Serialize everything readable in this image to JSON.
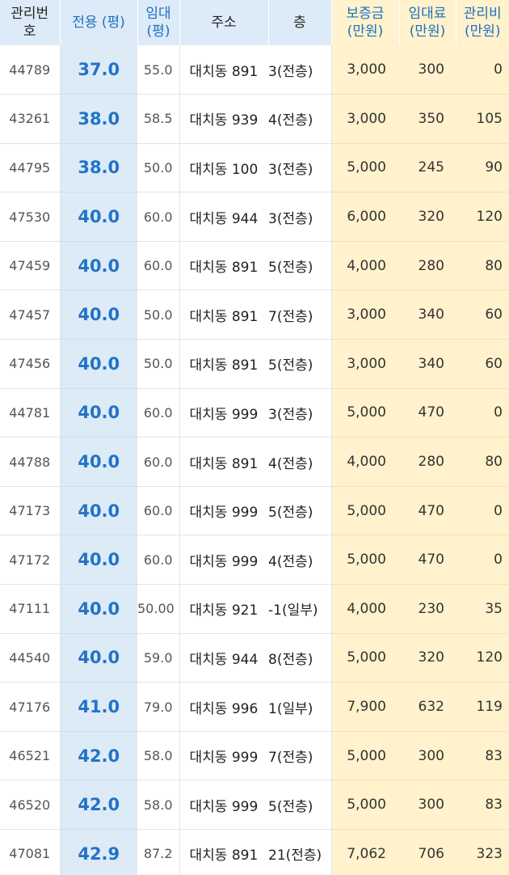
{
  "headers": {
    "id": [
      "관리번",
      "호"
    ],
    "area": [
      "전용 (평)"
    ],
    "rent_area": [
      "임대",
      "(평)"
    ],
    "address": [
      "주소"
    ],
    "floor": [
      "층"
    ],
    "deposit": [
      "보증금",
      "(만원)"
    ],
    "monthly": [
      "임대료",
      "(만원)"
    ],
    "fee": [
      "관리비",
      "(만원)"
    ]
  },
  "colors": {
    "area_column_bg": "#ddebf7",
    "area_text": "#2273c8",
    "money_columns_bg": "#fff2cc",
    "header_bg": "#dcebf7"
  },
  "rows": [
    {
      "id": "44789",
      "area": "37.0",
      "rent_area": "55.0",
      "address": "대치동 891",
      "floor": "3(전층)",
      "deposit": "3,000",
      "monthly": "300",
      "fee": "0"
    },
    {
      "id": "43261",
      "area": "38.0",
      "rent_area": "58.5",
      "address": "대치동 939",
      "floor": "4(전층)",
      "deposit": "3,000",
      "monthly": "350",
      "fee": "105"
    },
    {
      "id": "44795",
      "area": "38.0",
      "rent_area": "50.0",
      "address": "대치동 100",
      "floor": "3(전층)",
      "deposit": "5,000",
      "monthly": "245",
      "fee": "90"
    },
    {
      "id": "47530",
      "area": "40.0",
      "rent_area": "60.0",
      "address": "대치동 944",
      "floor": "3(전층)",
      "deposit": "6,000",
      "monthly": "320",
      "fee": "120"
    },
    {
      "id": "47459",
      "area": "40.0",
      "rent_area": "60.0",
      "address": "대치동 891",
      "floor": "5(전층)",
      "deposit": "4,000",
      "monthly": "280",
      "fee": "80"
    },
    {
      "id": "47457",
      "area": "40.0",
      "rent_area": "50.0",
      "address": "대치동 891",
      "floor": "7(전층)",
      "deposit": "3,000",
      "monthly": "340",
      "fee": "60"
    },
    {
      "id": "47456",
      "area": "40.0",
      "rent_area": "50.0",
      "address": "대치동 891",
      "floor": "5(전층)",
      "deposit": "3,000",
      "monthly": "340",
      "fee": "60"
    },
    {
      "id": "44781",
      "area": "40.0",
      "rent_area": "60.0",
      "address": "대치동 999",
      "floor": "3(전층)",
      "deposit": "5,000",
      "monthly": "470",
      "fee": "0"
    },
    {
      "id": "44788",
      "area": "40.0",
      "rent_area": "60.0",
      "address": "대치동 891",
      "floor": "4(전층)",
      "deposit": "4,000",
      "monthly": "280",
      "fee": "80"
    },
    {
      "id": "47173",
      "area": "40.0",
      "rent_area": "60.0",
      "address": "대치동 999",
      "floor": "5(전층)",
      "deposit": "5,000",
      "monthly": "470",
      "fee": "0"
    },
    {
      "id": "47172",
      "area": "40.0",
      "rent_area": "60.0",
      "address": "대치동 999",
      "floor": "4(전층)",
      "deposit": "5,000",
      "monthly": "470",
      "fee": "0"
    },
    {
      "id": "47111",
      "area": "40.0",
      "rent_area": "50.00",
      "address": "대치동 921",
      "floor": "-1(일부)",
      "deposit": "4,000",
      "monthly": "230",
      "fee": "35"
    },
    {
      "id": "44540",
      "area": "40.0",
      "rent_area": "59.0",
      "address": "대치동 944",
      "floor": "8(전층)",
      "deposit": "5,000",
      "monthly": "320",
      "fee": "120"
    },
    {
      "id": "47176",
      "area": "41.0",
      "rent_area": "79.0",
      "address": "대치동 996",
      "floor": "1(일부)",
      "deposit": "7,900",
      "monthly": "632",
      "fee": "119"
    },
    {
      "id": "46521",
      "area": "42.0",
      "rent_area": "58.0",
      "address": "대치동 999",
      "floor": "7(전층)",
      "deposit": "5,000",
      "monthly": "300",
      "fee": "83"
    },
    {
      "id": "46520",
      "area": "42.0",
      "rent_area": "58.0",
      "address": "대치동 999",
      "floor": "5(전층)",
      "deposit": "5,000",
      "monthly": "300",
      "fee": "83"
    },
    {
      "id": "47081",
      "area": "42.9",
      "rent_area": "87.2",
      "address": "대치동 891",
      "floor": "21(전층)",
      "deposit": "7,062",
      "monthly": "706",
      "fee": "323"
    }
  ]
}
